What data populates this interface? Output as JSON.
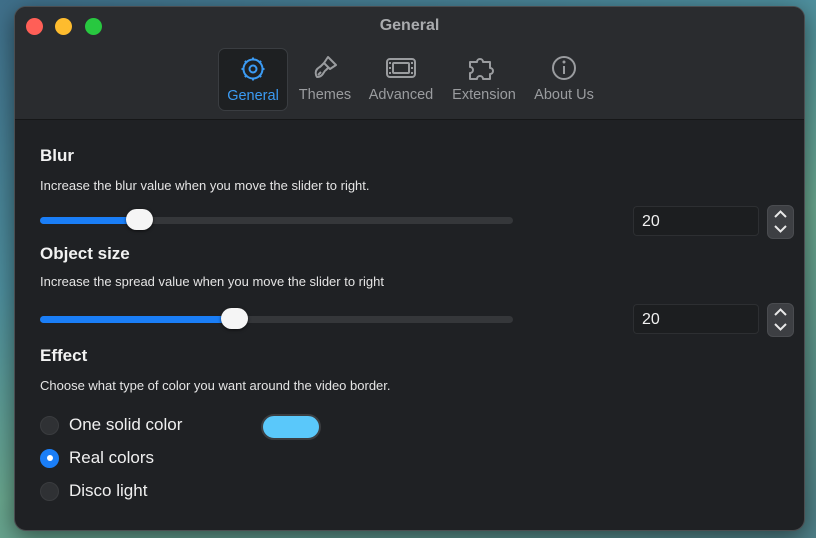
{
  "window": {
    "title": "General"
  },
  "tabs": [
    {
      "label": "General",
      "icon": "gear-icon",
      "active": true
    },
    {
      "label": "Themes",
      "icon": "paintbrush-icon",
      "active": false
    },
    {
      "label": "Advanced",
      "icon": "film-icon",
      "active": false
    },
    {
      "label": "Extension",
      "icon": "puzzle-piece-icon",
      "active": false
    },
    {
      "label": "About Us",
      "icon": "info-icon",
      "active": false
    }
  ],
  "blur": {
    "heading": "Blur",
    "description": "Increase the blur value when you move the slider to right.",
    "value": "20",
    "slider_fraction": 0.21
  },
  "object_size": {
    "heading": "Object size",
    "description": "Increase the spread value when you move the slider to right",
    "value": "20",
    "slider_fraction": 0.41
  },
  "effect": {
    "heading": "Effect",
    "description": "Choose what type of color you want around the video border.",
    "options": [
      {
        "label": "One solid color",
        "selected": false
      },
      {
        "label": "Real colors",
        "selected": true
      },
      {
        "label": "Disco light",
        "selected": false
      }
    ],
    "solid_color": "#5ac8fa"
  },
  "colors": {
    "accent": "#1a7ef7",
    "active_tab": "#3b9bf4"
  }
}
